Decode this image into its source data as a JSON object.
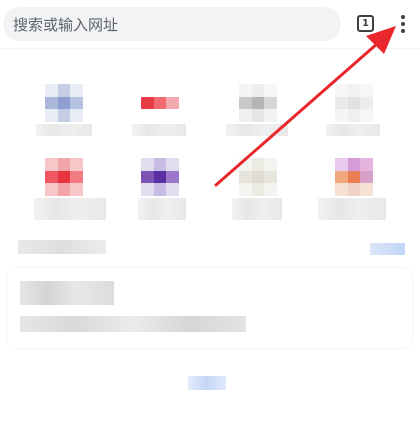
{
  "omnibox": {
    "placeholder": "搜索或输入网址"
  },
  "toolbar": {
    "tab_count": "1",
    "menu_icon": "more-vert-icon"
  },
  "colors": {
    "omnibox_bg": "#f1f3f4",
    "annotation_arrow": "#e8262c"
  },
  "shortcuts": [
    {
      "icon_colors": [
        "#e8ecf5",
        "#c3cde6",
        "#e8ecf5",
        "#aab8dc",
        "#8ea0d2",
        "#b5c2e2",
        "#e8ecf5",
        "#c3cde6",
        "#e8ecf5"
      ]
    },
    {
      "icon_colors": [
        "#ffffff",
        "#ffffff",
        "#ffffff",
        "#e83c46",
        "#f06a72",
        "#f2a9ad",
        "#ffffff",
        "#ffffff",
        "#ffffff"
      ]
    },
    {
      "icon_colors": [
        "#f4f4f4",
        "#eeeeee",
        "#f6f6f6",
        "#c8c8c8",
        "#b5b5b5",
        "#d6d6d6",
        "#efefef",
        "#e5e5e5",
        "#f2f2f2"
      ]
    },
    {
      "icon_colors": [
        "#f7f7f7",
        "#f2f2f2",
        "#f6f6f6",
        "#eaeaea",
        "#e1e1e1",
        "#ececec",
        "#f5f5f5",
        "#efefef",
        "#f6f6f6"
      ]
    },
    {
      "icon_colors": [
        "#f7c6c9",
        "#f3a4a9",
        "#f7c6c9",
        "#f05762",
        "#e8343f",
        "#f37c84",
        "#f7c6c9",
        "#f3a4a9",
        "#f7c6c9"
      ]
    },
    {
      "icon_colors": [
        "#e2dcef",
        "#c7bce4",
        "#e2dcef",
        "#7c54b6",
        "#5a2ea3",
        "#9b78cb",
        "#e2dcef",
        "#c7bce4",
        "#e2dcef"
      ]
    },
    {
      "icon_colors": [
        "#f3f3ef",
        "#ecebe3",
        "#f3f3ef",
        "#e6e4da",
        "#dedbd0",
        "#e8e6dc",
        "#f3f3ef",
        "#ecebe3",
        "#f3f3ef"
      ]
    },
    {
      "icon_colors": [
        "#e9c9ec",
        "#d59bd7",
        "#e6b5df",
        "#f0a77e",
        "#e97e55",
        "#d7a0c9",
        "#f6e0d2",
        "#efd2c5",
        "#f6e3d6"
      ]
    }
  ]
}
